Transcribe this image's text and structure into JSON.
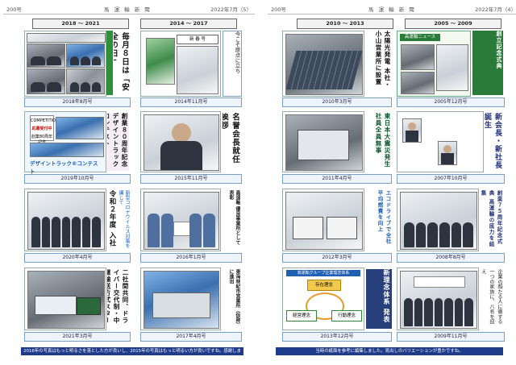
{
  "left": {
    "page_num": "200号",
    "paper_name": "馬 運 輸 新 聞",
    "date": "2022年7月（5）",
    "col1_range": "2018 〜 2021",
    "col2_range": "2014 〜 2017",
    "items": [
      {
        "caption": "2018年8月号",
        "title": "毎月８日は「安全の日」"
      },
      {
        "caption": "2019年10月号",
        "title": "創業８０周年記念 デザイントラック コンテスト",
        "sub": "デザイントラック®コンテスト",
        "logo_line1": "COMPETITION",
        "logo_line2": "応募受付中",
        "logo_line3": "創業80周年記念"
      },
      {
        "caption": "2020年4月号",
        "title": "令和２年度 入社式",
        "sub": "新型コロナウイルス対策を講じて"
      },
      {
        "caption": "2021年3月号",
        "title": "二社間共同、ドライバー交代制・中継輸送方式スタート"
      },
      {
        "caption": "2014年11月号",
        "title": "今こそ原点に立ち",
        "sub": "新 春 号"
      },
      {
        "caption": "2015年11月号",
        "title": "名誉会長就任　挨拶"
      },
      {
        "caption": "2016年1月号",
        "title": "高速軸 優良事業所として表彰"
      },
      {
        "caption": "2017年4月号",
        "title": "東海林紀市営業所（仮称）に進出"
      }
    ],
    "footer": "2016年の写真はもっと明るさを落とした方が良いし、2015年の写真はもっと明るい方が良いですね。感謝します。"
  },
  "right": {
    "page_num": "200号",
    "paper_name": "馬 運 輸 新 聞",
    "date": "2022年7月（4）",
    "col1_range": "2010 〜 2013",
    "col2_range": "2005 〜 2009",
    "items": [
      {
        "caption": "2010年3月号",
        "title": "太陽光発電 本社・小山営業所に設置"
      },
      {
        "caption": "2011年4月号",
        "title": "東日本大震災発生 社員全員無事"
      },
      {
        "caption": "2012年3月号",
        "title": "エコドライブで全社平均燃費を向上"
      },
      {
        "caption": "2013年12月号",
        "title": "新理念体系 発表",
        "diag1": "存在理念",
        "diag2": "経営理念",
        "diag3": "行動理念",
        "diag_head": "高運輸グループ企業理念体系"
      },
      {
        "caption": "2005年12月号",
        "title": "創立記念式典",
        "news": "高運輸ニュース"
      },
      {
        "caption": "2007年10月号",
        "title": "新会長・新社長　誕生"
      },
      {
        "caption": "2008年8月号",
        "title": "創業７５周年記念式典 高運輸の底力を結集"
      },
      {
        "caption": "2009年11月号",
        "title": "企業の顔たる人に徹する 一つの家族に、八名を迎え"
      }
    ],
    "footer": "当時の紙面を参考に編集しました。見出しのバリエーションが豊かですね。"
  }
}
